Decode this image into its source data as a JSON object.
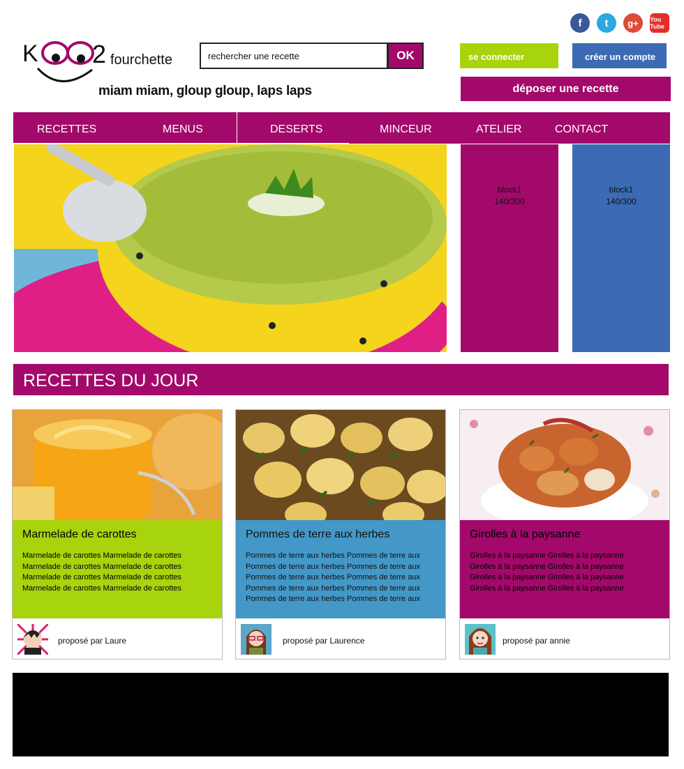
{
  "social": [
    {
      "name": "facebook-icon",
      "glyph": "f"
    },
    {
      "name": "twitter-icon",
      "glyph": "t"
    },
    {
      "name": "google-plus-icon",
      "glyph": "g+"
    },
    {
      "name": "youtube-icon",
      "glyph": "You Tube"
    }
  ],
  "logo": {
    "letters": "K",
    "two": "2",
    "word": "fourchette",
    "tagline": "miam miam, gloup gloup, laps laps"
  },
  "search": {
    "placeholder": "rechercher une recette",
    "button": "OK"
  },
  "auth": {
    "login": "se connecter",
    "register": "créer un compte",
    "submit_recipe": "déposer une recette"
  },
  "nav": [
    "RECETTES",
    "MENUS",
    "DESERTS",
    "MINCEUR",
    "ATELIER",
    "CONTACT"
  ],
  "blocks": [
    {
      "title": "block1",
      "size": "140/300"
    },
    {
      "title": "block1",
      "size": "140/300"
    }
  ],
  "section_title": "RECETTES DU JOUR",
  "cards": [
    {
      "title": "Marmelade de carottes",
      "lines": [
        "Marmelade de carottes Marmelade de carottes",
        "Marmelade de carottes Marmelade de carottes",
        "Marmelade de carottes Marmelade de carottes",
        "Marmelade de carottes Marmelade de carottes"
      ],
      "author": "proposé par Laure"
    },
    {
      "title": "Pommes de terre aux herbes",
      "lines": [
        "Pommes de terre aux herbes Pommes de terre aux",
        "Pommes de terre aux herbes Pommes de terre aux",
        "Pommes de terre aux herbes Pommes de terre aux",
        "Pommes de terre aux herbes Pommes de terre aux",
        "Pommes de terre aux herbes Pommes de terre aux"
      ],
      "author": "proposé par Laurence"
    },
    {
      "title": "Girolles à la paysanne",
      "lines": [
        "Girolles à la paysanne Girolles à la paysanne",
        "Girolles à la paysanne Girolles à la paysanne",
        "Girolles à la paysanne Girolles à la paysanne",
        "Girolles à la paysanne Girolles à la paysanne"
      ],
      "author": "proposé par annie"
    }
  ],
  "colors": {
    "pink": "#a3096b",
    "green": "#a8d40d",
    "blue": "#3c6bb4",
    "card_blue": "#4398c8"
  }
}
